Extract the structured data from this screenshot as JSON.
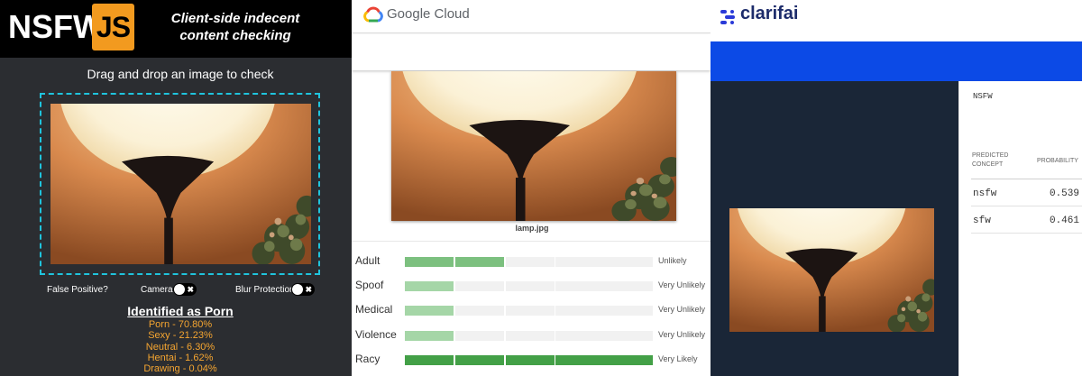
{
  "nsfwjs": {
    "logo_text": "NSFW",
    "logo_badge": "JS",
    "tagline": "Client-side indecent content checking",
    "drop_title": "Drag and drop an image to check",
    "false_positive": "False Positive?",
    "camera_label": "Camera",
    "blur_label": "Blur Protection",
    "toggle_x": "✖",
    "result_title": "Identified as Porn",
    "results": [
      "Porn - 70.80%",
      "Sexy - 21.23%",
      "Neutral - 6.30%",
      "Hentai - 1.62%",
      "Drawing - 0.04%"
    ],
    "colors": {
      "accent": "#f29a1f",
      "dashed_border": "#1fc4dd",
      "result_text": "#f5a531"
    }
  },
  "google_cloud": {
    "brand": "Google Cloud",
    "file_name": "lamp.jpg",
    "categories": [
      {
        "label": "Adult",
        "likelihood": "Unlikely",
        "level": 2,
        "color": "#7cc07f"
      },
      {
        "label": "Spoof",
        "likelihood": "Very Unlikely",
        "level": 1,
        "color": "#a5d6a7"
      },
      {
        "label": "Medical",
        "likelihood": "Very Unlikely",
        "level": 1,
        "color": "#a5d6a7"
      },
      {
        "label": "Violence",
        "likelihood": "Very Unlikely",
        "level": 1,
        "color": "#a5d6a7"
      },
      {
        "label": "Racy",
        "likelihood": "Very Likely",
        "level": 5,
        "color": "#43a047"
      }
    ]
  },
  "clarifai": {
    "brand": "clarifai",
    "model": "NSFW",
    "col_concept": "PREDICTED CONCEPT",
    "col_probability": "PROBABILITY",
    "concepts": [
      {
        "name": "nsfw",
        "probability": "0.539"
      },
      {
        "name": "sfw",
        "probability": "0.461"
      }
    ],
    "colors": {
      "header_blue": "#0c4ae6",
      "dark_panel": "#1a2637"
    }
  }
}
